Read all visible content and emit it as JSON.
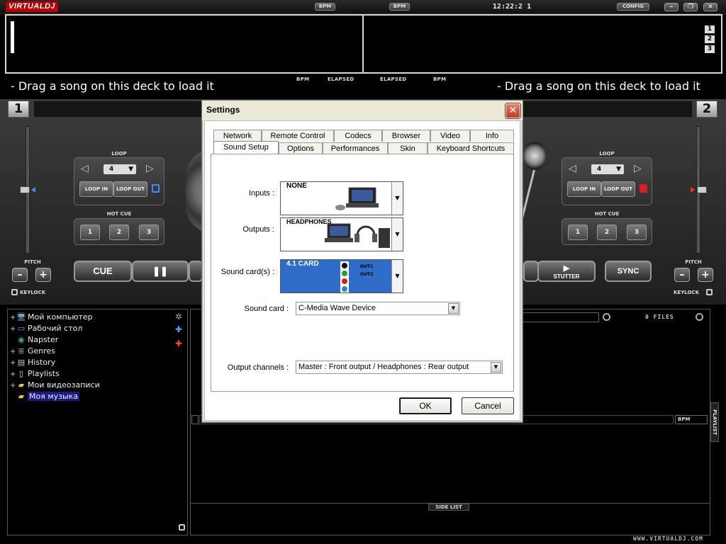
{
  "topbar": {
    "logo": "VIRTUALDJ",
    "bpm_left": "BPM",
    "bpm_right": "BPM",
    "clock": "12:22:2 1",
    "config": "CONFIG",
    "minimize": "–",
    "restore": "❐",
    "close": "✕"
  },
  "waveform": {
    "deck_numbers": [
      "1",
      "2",
      "3"
    ]
  },
  "info_labels": {
    "bpm_left": "BPM",
    "elapsed_left": "ELAPSED",
    "elapsed_right": "ELAPSED",
    "bpm_right": "BPM"
  },
  "deck1": {
    "number": "1",
    "drag_hint": "- Drag a song on this deck to load it",
    "loop_label": "LOOP",
    "loop_value": "4",
    "loop_in": "LOOP IN",
    "loop_out": "LOOP OUT",
    "hotcue_label": "HOT CUE",
    "hotcues": [
      "1",
      "2",
      "3"
    ],
    "pitch_label": "PITCH",
    "pitch_minus": "–",
    "pitch_plus": "+",
    "keylock": "KEYLOCK",
    "cue": "CUE",
    "pause": "❚❚"
  },
  "deck2": {
    "number": "2",
    "drag_hint": "- Drag a song on this deck to load it",
    "loop_label": "LOOP",
    "loop_value": "4",
    "loop_in": "LOOP IN",
    "loop_out": "LOOP OUT",
    "hotcue_label": "HOT CUE",
    "hotcues": [
      "1",
      "2",
      "3"
    ],
    "pitch_label": "PITCH",
    "pitch_minus": "–",
    "pitch_plus": "+",
    "keylock": "KEYLOCK",
    "stutter": "STUTTER",
    "sync": "SYNC"
  },
  "browser": {
    "tree": [
      {
        "label": "Мой компьютер",
        "icon": "computer-icon",
        "expandable": true
      },
      {
        "label": "Рабочий стол",
        "icon": "desktop-icon",
        "expandable": true
      },
      {
        "label": "Napster",
        "icon": "globe-icon",
        "expandable": false
      },
      {
        "label": "Genres",
        "icon": "stack-icon",
        "expandable": true
      },
      {
        "label": "History",
        "icon": "book-icon",
        "expandable": true
      },
      {
        "label": "Playlists",
        "icon": "page-icon",
        "expandable": true
      },
      {
        "label": "Мои видеозаписи",
        "icon": "folder-icon",
        "expandable": true
      },
      {
        "label": "Моя музыка",
        "icon": "folder-music-icon",
        "expandable": false,
        "selected": true
      }
    ],
    "files_label": "0 FILES",
    "bpm_column": "BPM",
    "playlist_tab": "PLAYLIST",
    "sidelist_tab": "SIDE LIST",
    "website": "WWW.VIRTUALDJ.COM"
  },
  "settings_dialog": {
    "title": "Settings",
    "tabs_row1": [
      "Network",
      "Remote Control",
      "Codecs",
      "Browser",
      "Video",
      "Info"
    ],
    "tabs_row2": [
      "Sound Setup",
      "Options",
      "Performances",
      "Skin",
      "Keyboard Shortcuts"
    ],
    "active_tab": "Sound Setup",
    "inputs_label": "Inputs :",
    "inputs_value": "NONE",
    "outputs_label": "Outputs :",
    "outputs_value": "HEADPHONES",
    "soundcards_label": "Sound card(s) :",
    "soundcards_value": "4.1 CARD",
    "soundcard_out1": "OUT1",
    "soundcard_out2": "OUT2",
    "soundcard_label": "Sound card :",
    "soundcard_value": "C-Media Wave Device",
    "output_channels_label": "Output channels :",
    "output_channels_value": "Master : Front output / Headphones : Rear output",
    "ok": "OK",
    "cancel": "Cancel"
  },
  "colors": {
    "soundcard_highlight": "#2f6bc9",
    "tree_selection": "#1a1a8a",
    "logo_red": "#b40000",
    "deck1_pitch_marker": "#3a8cff",
    "deck2_pitch_marker": "#ff2a2a"
  }
}
